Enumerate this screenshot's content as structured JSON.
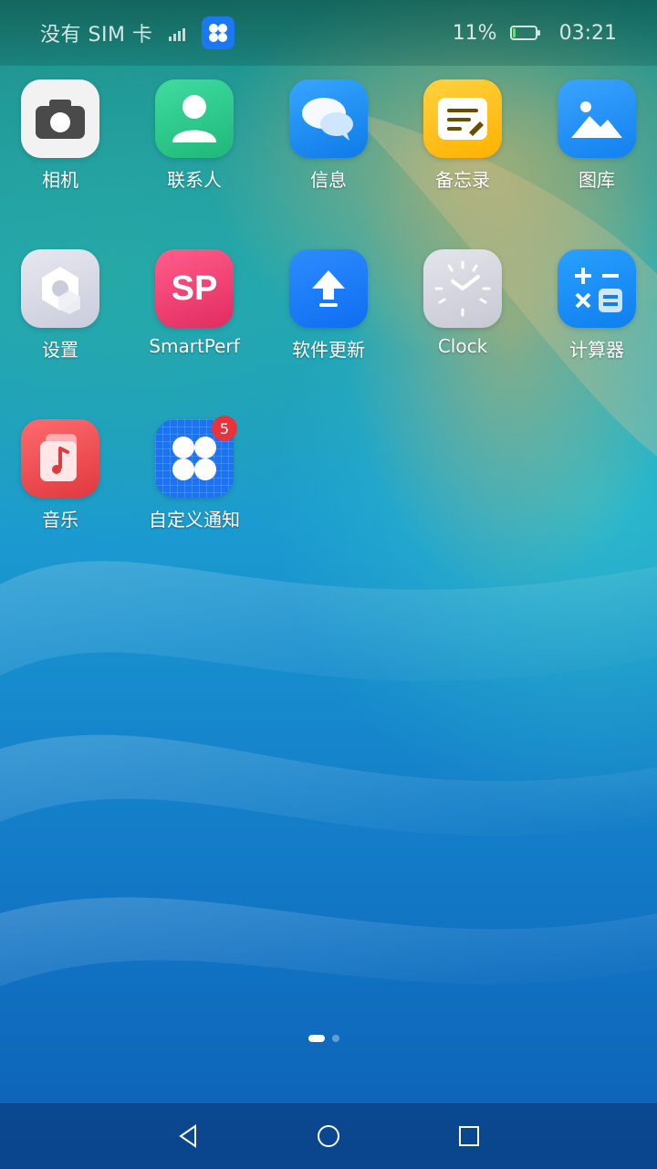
{
  "status_bar": {
    "carrier": "没有 SIM 卡",
    "battery": "11%",
    "battery_level": 0.11,
    "time": "03:21"
  },
  "apps": [
    {
      "label": "相机",
      "icon": "camera-icon"
    },
    {
      "label": "联系人",
      "icon": "contacts-icon"
    },
    {
      "label": "信息",
      "icon": "messages-icon"
    },
    {
      "label": "备忘录",
      "icon": "notepad-icon"
    },
    {
      "label": "图库",
      "icon": "gallery-icon"
    },
    {
      "label": "设置",
      "icon": "settings-icon"
    },
    {
      "label": "SmartPerf",
      "icon": "smartperf-icon",
      "icon_text": "SP"
    },
    {
      "label": "软件更新",
      "icon": "software-update-icon"
    },
    {
      "label": "Clock",
      "icon": "clock-icon"
    },
    {
      "label": "计算器",
      "icon": "calculator-icon"
    },
    {
      "label": "音乐",
      "icon": "music-icon"
    },
    {
      "label": "自定义通知",
      "icon": "custom-notification-icon",
      "badge": "5"
    }
  ],
  "page_indicator": {
    "pages": 2,
    "current": 1
  },
  "nav_bar": {
    "buttons": [
      "back-icon",
      "home-icon",
      "recents-icon"
    ]
  },
  "colors": {
    "camera_bg": "#f2f2f2",
    "contacts_bg": "#2fcc8e",
    "messages_bg": "#1e8ff2",
    "notepad_bg": "#ffc21a",
    "gallery_bg": "#1a8ef5",
    "settings_bg": "#d6d8e4",
    "smartperf_bg": "#ef3e73",
    "update_bg": "#1277f2",
    "clock_bg": "#d5d6df",
    "calculator_bg": "#178bf5",
    "music_bg": "#e84a4e",
    "custom_notif_bg": "#1b73f0",
    "badge": "#e8333a"
  }
}
